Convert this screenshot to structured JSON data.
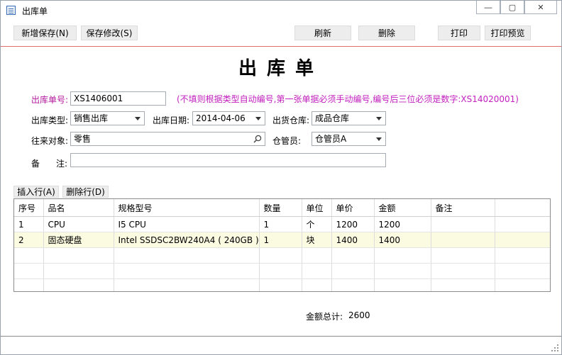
{
  "window": {
    "title": "出库单",
    "minimize": "―",
    "maximize": "▢",
    "close": "✕"
  },
  "toolbar": {
    "new_save": "新增保存(N)",
    "save_edit": "保存修改(S)",
    "refresh": "刷新",
    "delete": "删除",
    "print": "打印",
    "print_preview": "打印预览"
  },
  "form": {
    "title": "出库单",
    "order_no_label": "出库单号:",
    "order_no_value": "XS1406001",
    "hint": "(不填则根据类型自动编号,第一张单据必须手动编号,编号后三位必须是数字:XS14020001)",
    "type_label": "出库类型:",
    "type_value": "销售出库",
    "date_label": "出库日期:",
    "date_value": "2014-04-06",
    "warehouse_label": "出货仓库:",
    "warehouse_value": "成品仓库",
    "partner_label": "往来对象:",
    "partner_value": "零售",
    "keeper_label": "仓管员:",
    "keeper_value": "仓管员A",
    "remark_label_1": "备",
    "remark_label_2": "注:",
    "remark_value": ""
  },
  "grid_actions": {
    "insert": "插入行(A)",
    "delete": "删除行(D)"
  },
  "grid": {
    "columns": [
      "序号",
      "品名",
      "规格型号",
      "数量",
      "单位",
      "单价",
      "金额",
      "备注"
    ],
    "rows": [
      [
        "1",
        "CPU",
        "I5 CPU",
        "1",
        "个",
        "1200",
        "1200",
        ""
      ],
      [
        "2",
        "固态硬盘",
        "Intel SSDSC2BW240A4 ( 240GB )",
        "1",
        "块",
        "1400",
        "1400",
        ""
      ]
    ],
    "selected_row": 2
  },
  "total": {
    "label": "金额总计:",
    "value": "2600"
  },
  "colors": {
    "label_pink": "#b5179e",
    "hint_pink": "#c21fbf",
    "toolbar_divider": "#e06c6c",
    "selected_row_bg": "#fbfbe2"
  },
  "icons": [
    "app-window-icon",
    "search-icon",
    "chevron-down-icon",
    "resize-grip-icon"
  ]
}
